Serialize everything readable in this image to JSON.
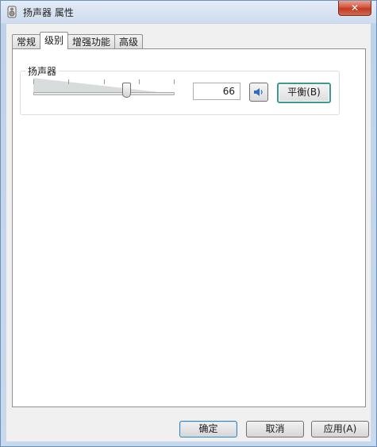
{
  "window": {
    "title": "扬声器 属性",
    "close_glyph": "✕",
    "icon": "speaker-properties-icon"
  },
  "tabs": [
    {
      "label": "常规",
      "active": false
    },
    {
      "label": "级别",
      "active": true
    },
    {
      "label": "增强功能",
      "active": false
    },
    {
      "label": "高级",
      "active": false
    }
  ],
  "levels": {
    "group_label": "扬声器",
    "volume_value": "66",
    "volume_fraction": 0.66,
    "mute_icon": "speaker-volume-icon",
    "balance_label": "平衡(B)"
  },
  "footer": {
    "ok_label": "确定",
    "cancel_label": "取消",
    "apply_label": "应用(A)"
  },
  "colors": {
    "focus_border": "#3b9a92",
    "close_red": "#c13b22"
  }
}
